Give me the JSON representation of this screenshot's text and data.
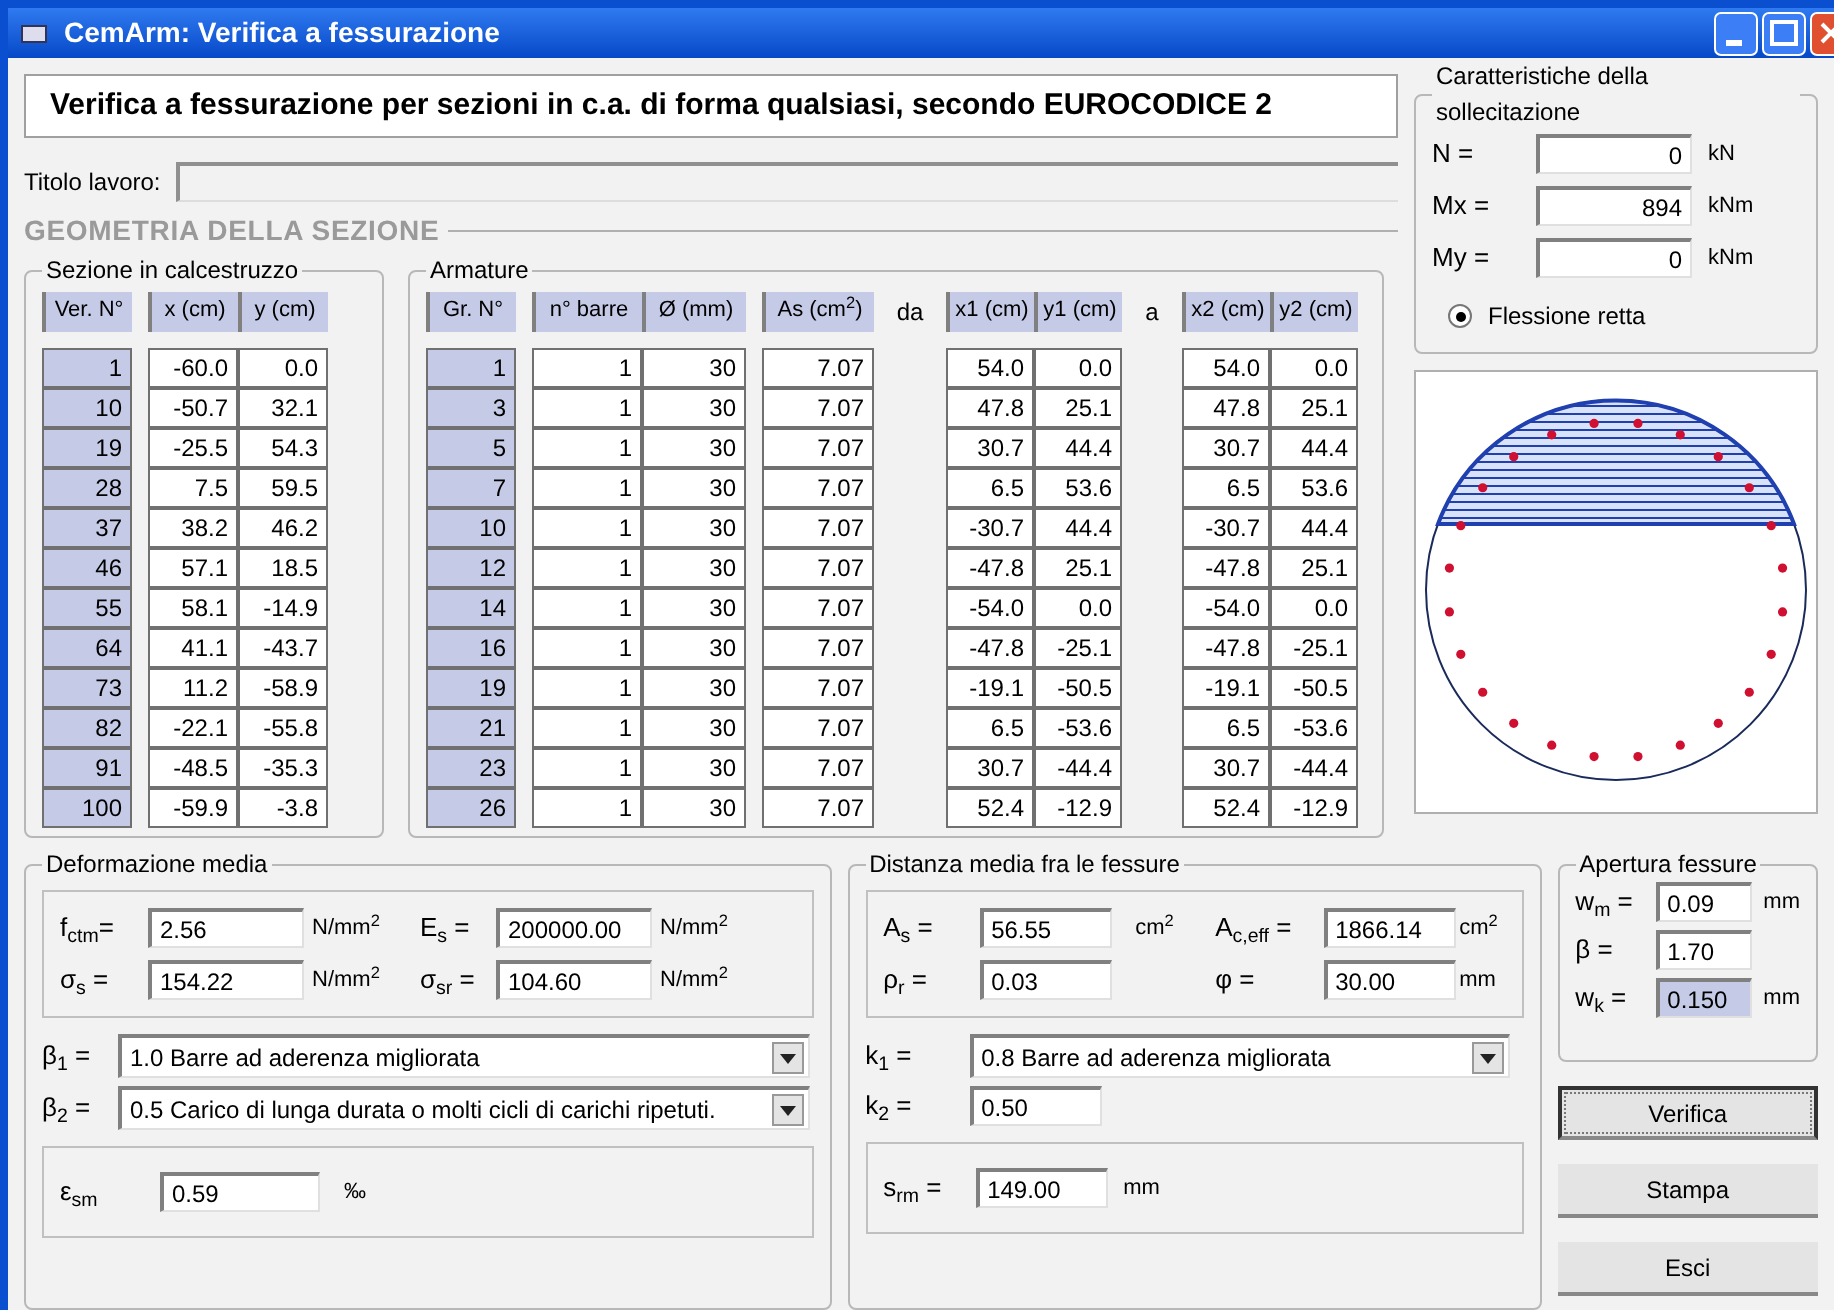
{
  "window": {
    "title": "CemArm: Verifica a fessurazione"
  },
  "heading": "Verifica a fessurazione per sezioni in c.a. di forma qualsiasi, secondo EUROCODICE 2",
  "job_title": {
    "label": "Titolo lavoro:"
  },
  "geometry": {
    "title": "GEOMETRIA DELLA SEZIONE",
    "concrete": {
      "title": "Sezione in calcestruzzo",
      "columns": [
        "Ver. N°",
        "x (cm)",
        "y (cm)"
      ],
      "rows": [
        [
          "1",
          "-60.0",
          "0.0"
        ],
        [
          "10",
          "-50.7",
          "32.1"
        ],
        [
          "19",
          "-25.5",
          "54.3"
        ],
        [
          "28",
          "7.5",
          "59.5"
        ],
        [
          "37",
          "38.2",
          "46.2"
        ],
        [
          "46",
          "57.1",
          "18.5"
        ],
        [
          "55",
          "58.1",
          "-14.9"
        ],
        [
          "64",
          "41.1",
          "-43.7"
        ],
        [
          "73",
          "11.2",
          "-58.9"
        ],
        [
          "82",
          "-22.1",
          "-55.8"
        ],
        [
          "91",
          "-48.5",
          "-35.3"
        ],
        [
          "100",
          "-59.9",
          "-3.8"
        ]
      ]
    },
    "reinforcement": {
      "title": "Armature",
      "columns": [
        "Gr. N°",
        "n° barre",
        "Ø (mm)",
        "As (cm$^{2}$)",
        "x1 (cm)",
        "y1 (cm)",
        "x2 (cm)",
        "y2 (cm)"
      ],
      "from_label": "da",
      "to_label": "a",
      "rows": [
        [
          "1",
          "1",
          "30",
          "7.07",
          "54.0",
          "0.0",
          "54.0",
          "0.0"
        ],
        [
          "3",
          "1",
          "30",
          "7.07",
          "47.8",
          "25.1",
          "47.8",
          "25.1"
        ],
        [
          "5",
          "1",
          "30",
          "7.07",
          "30.7",
          "44.4",
          "30.7",
          "44.4"
        ],
        [
          "7",
          "1",
          "30",
          "7.07",
          "6.5",
          "53.6",
          "6.5",
          "53.6"
        ],
        [
          "10",
          "1",
          "30",
          "7.07",
          "-30.7",
          "44.4",
          "-30.7",
          "44.4"
        ],
        [
          "12",
          "1",
          "30",
          "7.07",
          "-47.8",
          "25.1",
          "-47.8",
          "25.1"
        ],
        [
          "14",
          "1",
          "30",
          "7.07",
          "-54.0",
          "0.0",
          "-54.0",
          "0.0"
        ],
        [
          "16",
          "1",
          "30",
          "7.07",
          "-47.8",
          "-25.1",
          "-47.8",
          "-25.1"
        ],
        [
          "19",
          "1",
          "30",
          "7.07",
          "-19.1",
          "-50.5",
          "-19.1",
          "-50.5"
        ],
        [
          "21",
          "1",
          "30",
          "7.07",
          "6.5",
          "-53.6",
          "6.5",
          "-53.6"
        ],
        [
          "23",
          "1",
          "30",
          "7.07",
          "30.7",
          "-44.4",
          "30.7",
          "-44.4"
        ],
        [
          "26",
          "1",
          "30",
          "7.07",
          "52.4",
          "-12.9",
          "52.4",
          "-12.9"
        ]
      ]
    }
  },
  "loads": {
    "title": "Caratteristiche della sollecitazione",
    "fields": [
      {
        "label": "N =",
        "value": "0",
        "unit": "kN"
      },
      {
        "label": "Mx =",
        "value": "894",
        "unit": "kNm"
      },
      {
        "label": "My =",
        "value": "0",
        "unit": "kNm"
      }
    ],
    "radio": {
      "label": "Flessione retta",
      "selected": true
    }
  },
  "mean_strain": {
    "title": "Deformazione media",
    "fields": [
      {
        "label": "f$_{ctm}$=",
        "value": "2.56",
        "unit": "N/mm$^{2}$"
      },
      {
        "label": "E$_{s}$ =",
        "value": "200000.00",
        "unit": "N/mm$^{2}$"
      },
      {
        "label": "σ$_{s}$ =",
        "value": "154.22",
        "unit": "N/mm$^{2}$"
      },
      {
        "label": "σ$_{sr}$ =",
        "value": "104.60",
        "unit": "N/mm$^{2}$"
      }
    ],
    "selects": [
      {
        "label": "β$_{1}$ =",
        "value": "1.0  Barre ad aderenza migliorata"
      },
      {
        "label": "β$_{2}$ =",
        "value": "0.5  Carico di lunga durata o molti cicli di carichi ripetuti."
      }
    ],
    "result": {
      "label": "ε$_{sm}$",
      "value": "0.59",
      "unit": "‰"
    }
  },
  "crack_spacing": {
    "title": "Distanza media fra le fessure",
    "fields": [
      {
        "label": "A$_{s}$ =",
        "value": "56.55",
        "unit": "cm$^{2}$"
      },
      {
        "label": "A$_{c,eff}$ =",
        "value": "1866.14",
        "unit": "cm$^{2}$"
      },
      {
        "label": "ρ$_{r}$ =",
        "value": "0.03"
      },
      {
        "label": "φ =",
        "value": "30.00",
        "unit": "mm"
      }
    ],
    "select": {
      "label": "k$_{1}$ =",
      "value": "0.8  Barre ad aderenza migliorata"
    },
    "k2": {
      "label": "k$_{2}$ =",
      "value": "0.50"
    },
    "result": {
      "label": "s$_{rm}$ =",
      "value": "149.00",
      "unit": "mm"
    }
  },
  "crack_width": {
    "title": "Apertura fessure",
    "fields": [
      {
        "label": "w$_{m}$ =",
        "value": "0.09",
        "unit": "mm",
        "highlighted": false
      },
      {
        "label": "β =",
        "value": "1.70",
        "highlighted": false
      },
      {
        "label": "w$_{k}$ =",
        "value": "0.150",
        "unit": "mm",
        "highlighted": true
      }
    ]
  },
  "buttons": [
    {
      "label": "Verifica",
      "focused": true
    },
    {
      "label": "Stampa",
      "focused": false
    },
    {
      "label": "Esci",
      "focused": false
    }
  ]
}
